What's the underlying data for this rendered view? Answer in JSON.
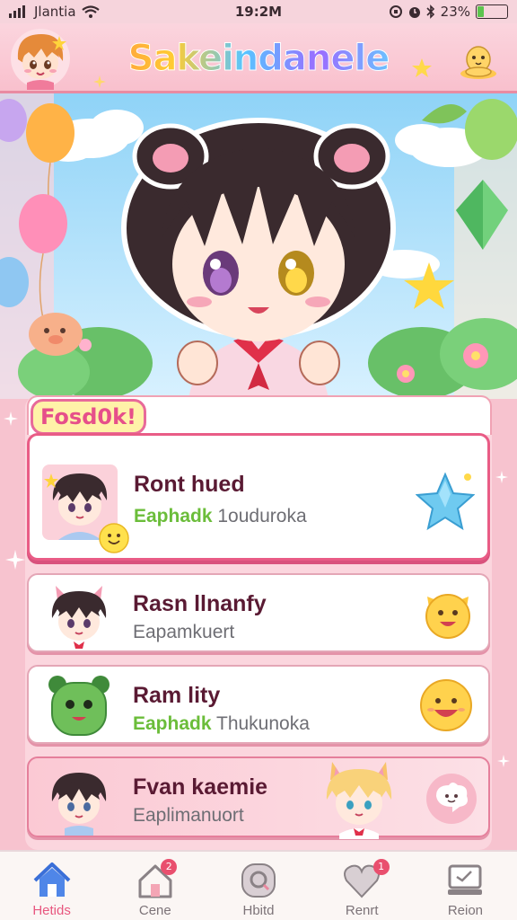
{
  "status_bar": {
    "carrier": "Jlantia",
    "time": "19:2M",
    "battery": "23%",
    "battery_level": 0.23
  },
  "header": {
    "title": "Sakeindanele",
    "icons": [
      "avatar",
      "star-icon",
      "plush-menu-icon"
    ]
  },
  "hero": {
    "description_icons": [
      "balloon-icon",
      "star-icon",
      "crystal-icon",
      "flower-icon"
    ]
  },
  "section": {
    "tag": "Fosd0k!"
  },
  "list": [
    {
      "title": "Ront hued",
      "sub_part1": "Eaphadk",
      "sub_part2": "1ouduroka",
      "icon": "star-icon",
      "featured": true
    },
    {
      "title": "Rasn llnanfy",
      "sub_part1": "",
      "sub_part2": "Eapamkuert",
      "icon": "smiley-icon",
      "featured": false
    },
    {
      "title": "Ram lity",
      "sub_part1": "Eaphadk",
      "sub_part2": "Thukunoka",
      "icon": "smiley-icon",
      "featured": false
    },
    {
      "title": "Fvan kaemie",
      "sub_part1": "",
      "sub_part2": "Eaplimanuort",
      "icon": "chat-icon",
      "featured": false
    }
  ],
  "bottom_nav": {
    "items": [
      {
        "label": "Hetids",
        "icon": "home-icon",
        "active": true,
        "badge": ""
      },
      {
        "label": "Cene",
        "icon": "house-icon",
        "active": false,
        "badge": "2"
      },
      {
        "label": "Hbitd",
        "icon": "search-icon",
        "active": false,
        "badge": ""
      },
      {
        "label": "Renrt",
        "icon": "heart-icon",
        "active": false,
        "badge": "1"
      },
      {
        "label": "Reion",
        "icon": "computer-icon",
        "active": false,
        "badge": ""
      }
    ]
  },
  "colors": {
    "accent": "#e8577f",
    "header_bg": "#f9c0cd",
    "card_title": "#5a1a33",
    "sub_green": "#6bbd3a"
  }
}
